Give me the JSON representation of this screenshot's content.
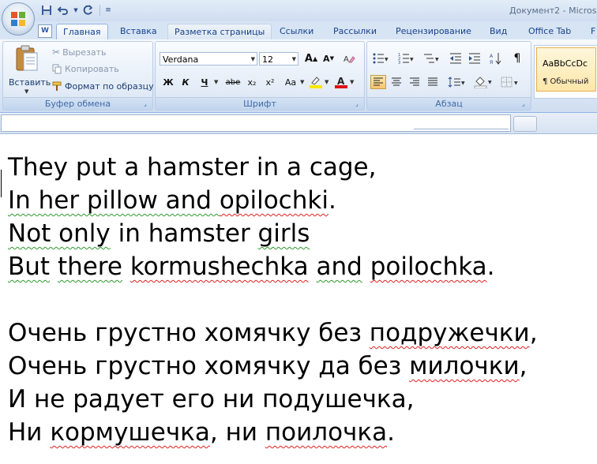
{
  "window": {
    "title": "Документ2 - Microso"
  },
  "quick_access": {
    "save_icon": "save-icon",
    "undo_icon": "undo-icon",
    "redo_icon": "redo-icon",
    "customize_icon": "customize-qat-icon"
  },
  "tabs": [
    {
      "label": "Главная",
      "active": true
    },
    {
      "label": "Вставка"
    },
    {
      "label": "Разметка страницы"
    },
    {
      "label": "Ссылки"
    },
    {
      "label": "Рассылки"
    },
    {
      "label": "Рецензирование"
    },
    {
      "label": "Вид"
    },
    {
      "label": "Office Tab"
    },
    {
      "label": "F"
    }
  ],
  "clipboard": {
    "paste_label": "Вставить",
    "cut_label": "Вырезать",
    "copy_label": "Копировать",
    "format_painter_label": "Формат по образцу",
    "group_label": "Буфер обмена"
  },
  "font": {
    "name": "Verdana",
    "size": "12",
    "group_label": "Шрифт",
    "buttons": {
      "bold": "Ж",
      "italic": "К",
      "underline": "Ч",
      "strike": "abe",
      "subscript": "x₂",
      "superscript": "x²",
      "case": "Aa"
    }
  },
  "paragraph": {
    "group_label": "Абзац"
  },
  "styles": {
    "sample": "AaBbCcDc",
    "normal_label": "¶ Обычный"
  },
  "document": {
    "lines": [
      {
        "words": [
          {
            "t": "They put a hamster in a cage,"
          }
        ]
      },
      {
        "words": [
          {
            "t": "In her pillow and ",
            "gr": true
          },
          {
            "t": "opilochki",
            "sp": true,
            "gr": true
          },
          {
            "t": "."
          }
        ]
      },
      {
        "words": [
          {
            "t": "Not only",
            "gr": true
          },
          {
            "t": " in hamster "
          },
          {
            "t": "girls",
            "gr": true
          }
        ]
      },
      {
        "words": [
          {
            "t": "But",
            "gr": true
          },
          {
            "t": " "
          },
          {
            "t": "there",
            "gr": true
          },
          {
            "t": " "
          },
          {
            "t": "kormushechka",
            "sp": true
          },
          {
            "t": " "
          },
          {
            "t": "and",
            "gr": true
          },
          {
            "t": " "
          },
          {
            "t": "poilochka",
            "sp": true
          },
          {
            "t": "."
          }
        ]
      },
      {
        "words": []
      },
      {
        "words": [
          {
            "t": "Очень грустно хомячку без "
          },
          {
            "t": "подружечки",
            "sp": true
          },
          {
            "t": ","
          }
        ]
      },
      {
        "words": [
          {
            "t": "Очень грустно хомячку да без "
          },
          {
            "t": "милочки",
            "sp": true
          },
          {
            "t": ","
          }
        ]
      },
      {
        "words": [
          {
            "t": "И не радует его ни подушечка,"
          }
        ]
      },
      {
        "words": [
          {
            "t": "Ни "
          },
          {
            "t": "кормушечка",
            "sp": true
          },
          {
            "t": ", ни "
          },
          {
            "t": "поилочка",
            "sp": true
          },
          {
            "t": "."
          }
        ]
      }
    ]
  }
}
